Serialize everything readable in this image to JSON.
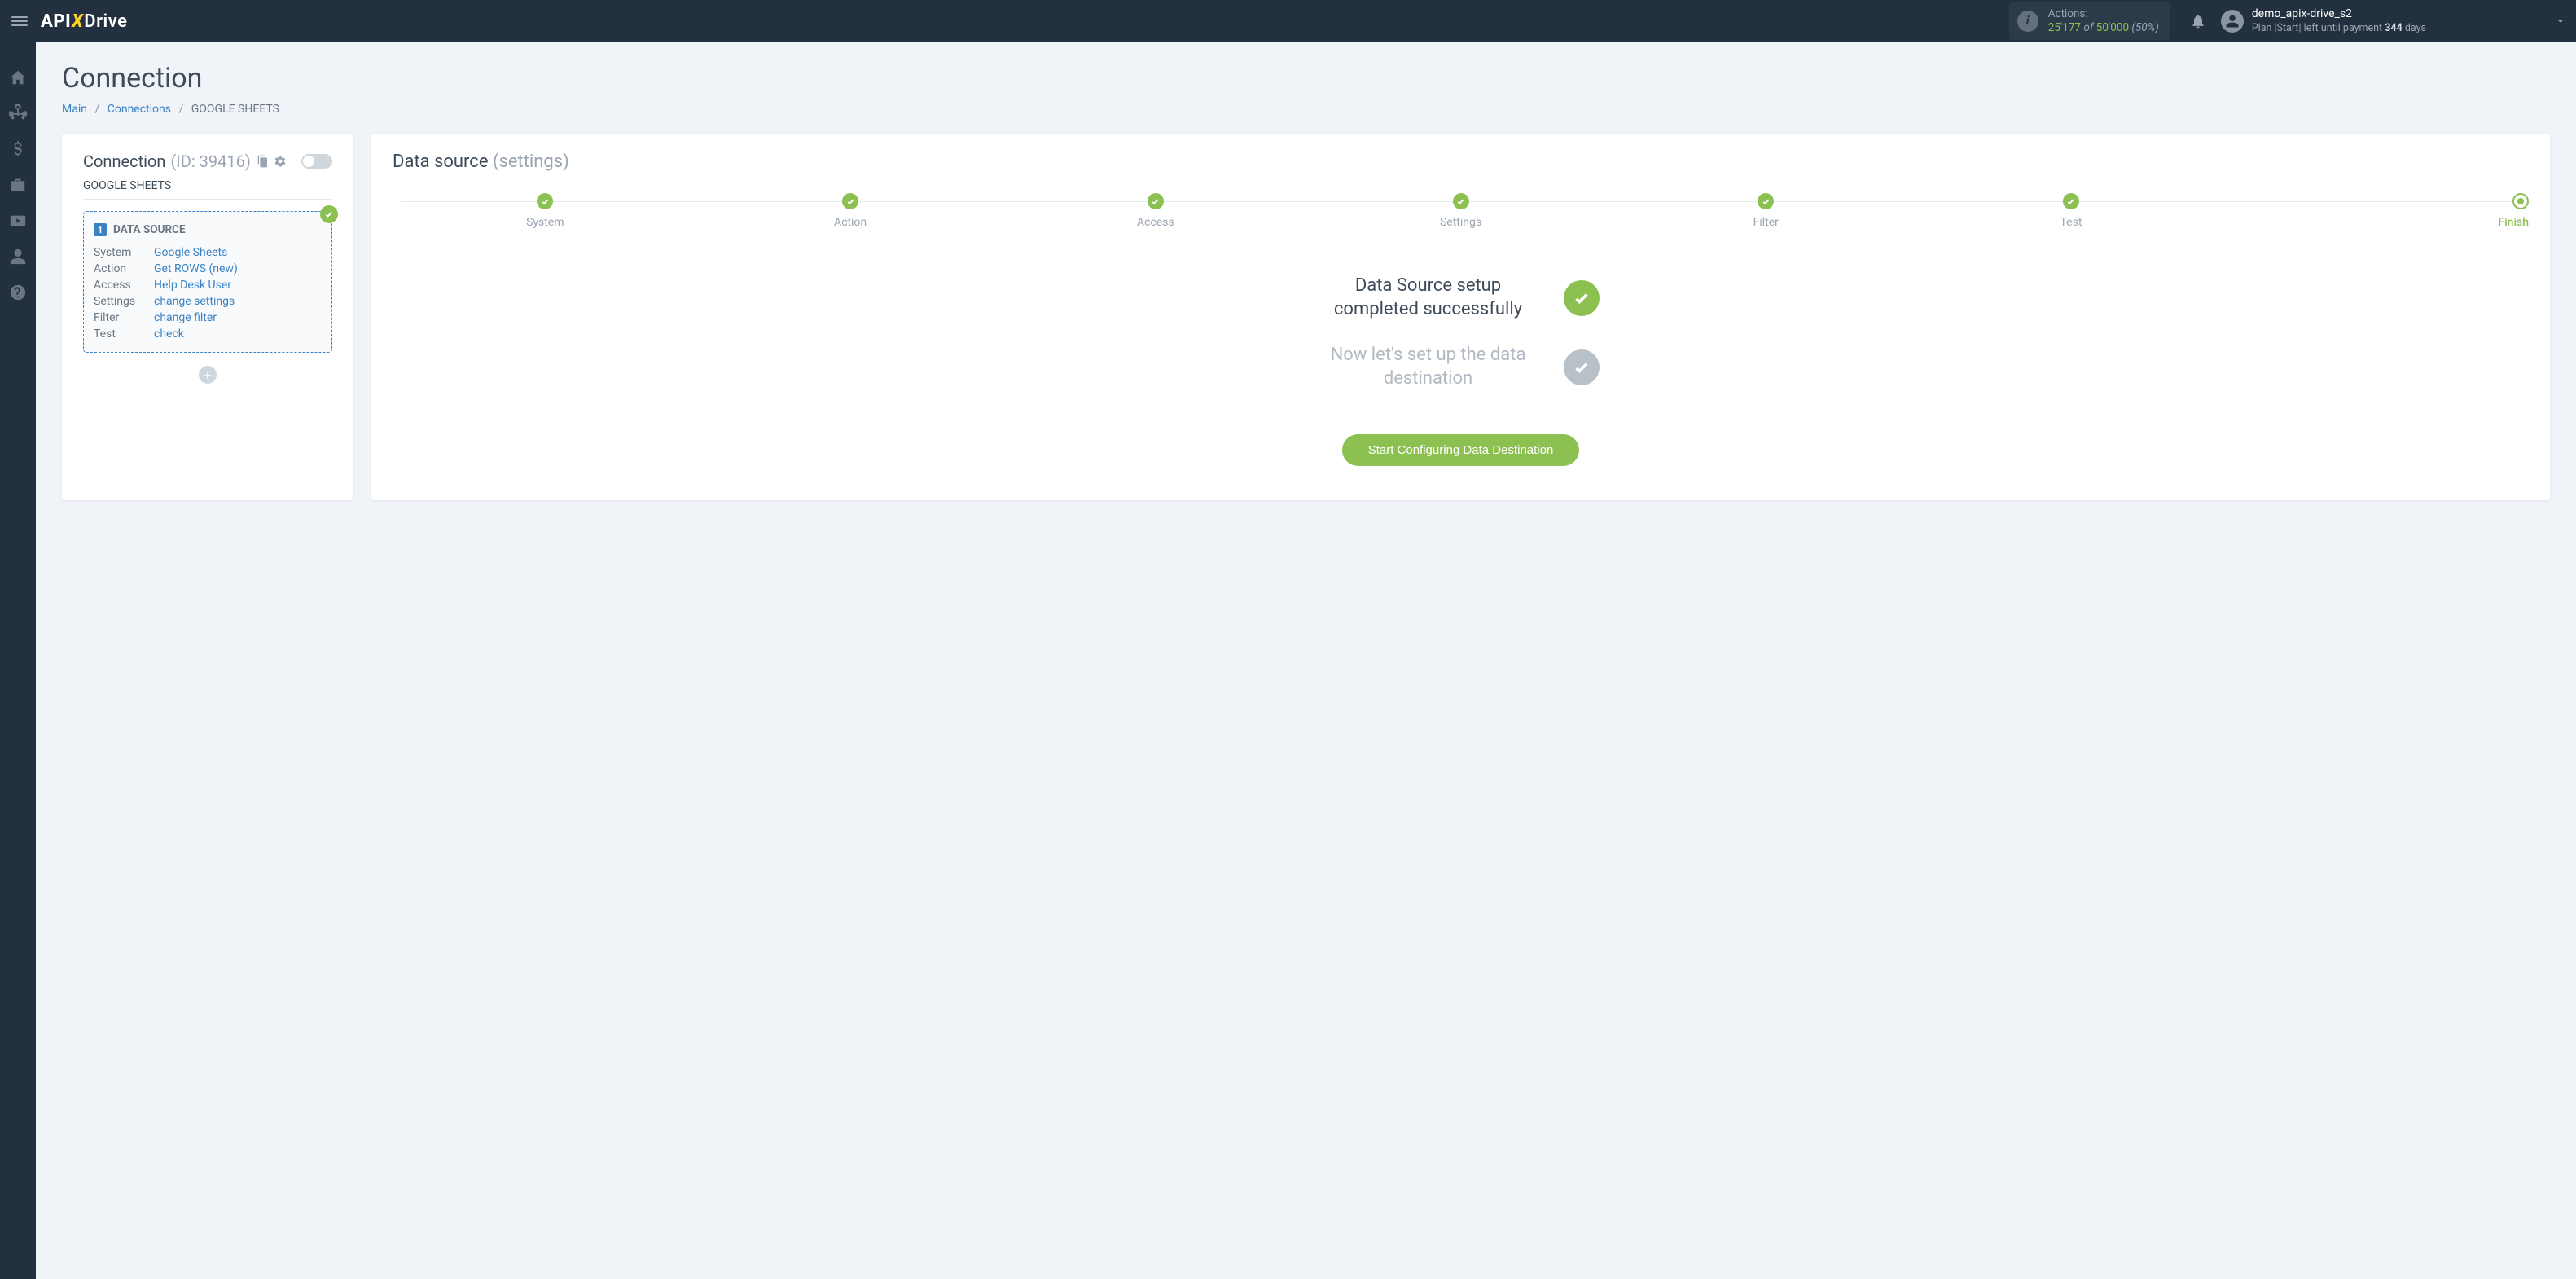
{
  "brand": {
    "api": "API",
    "x": "X",
    "drive": "Drive"
  },
  "topbar": {
    "actions_label": "Actions:",
    "actions_used": "25'177",
    "actions_of": "of",
    "actions_total": "50'000",
    "actions_pct": "(50%)",
    "username": "demo_apix-drive_s2",
    "plan_prefix": "Plan |",
    "plan_name": "Start",
    "plan_mid": "| left until payment ",
    "plan_days": "344",
    "plan_suffix": " days"
  },
  "page": {
    "title": "Connection",
    "breadcrumb": {
      "main": "Main",
      "connections": "Connections",
      "current": "GOOGLE SHEETS"
    }
  },
  "left": {
    "header": "Connection",
    "id_label": "(ID: 39416)",
    "subtitle": "GOOGLE SHEETS",
    "source_badge_num": "1",
    "source_title": "DATA SOURCE",
    "rows": [
      {
        "k": "System",
        "v": "Google Sheets"
      },
      {
        "k": "Action",
        "v": "Get ROWS (new)"
      },
      {
        "k": "Access",
        "v": "Help Desk User"
      },
      {
        "k": "Settings",
        "v": "change settings"
      },
      {
        "k": "Filter",
        "v": "change filter"
      },
      {
        "k": "Test",
        "v": "check"
      }
    ],
    "add_label": "+"
  },
  "right": {
    "title": "Data source",
    "subtitle": "(settings)",
    "steps": [
      "System",
      "Action",
      "Access",
      "Settings",
      "Filter",
      "Test",
      "Finish"
    ],
    "done_text": "Data Source setup completed successfully",
    "pending_text": "Now let's set up the data destination",
    "cta": "Start Configuring Data Destination"
  }
}
